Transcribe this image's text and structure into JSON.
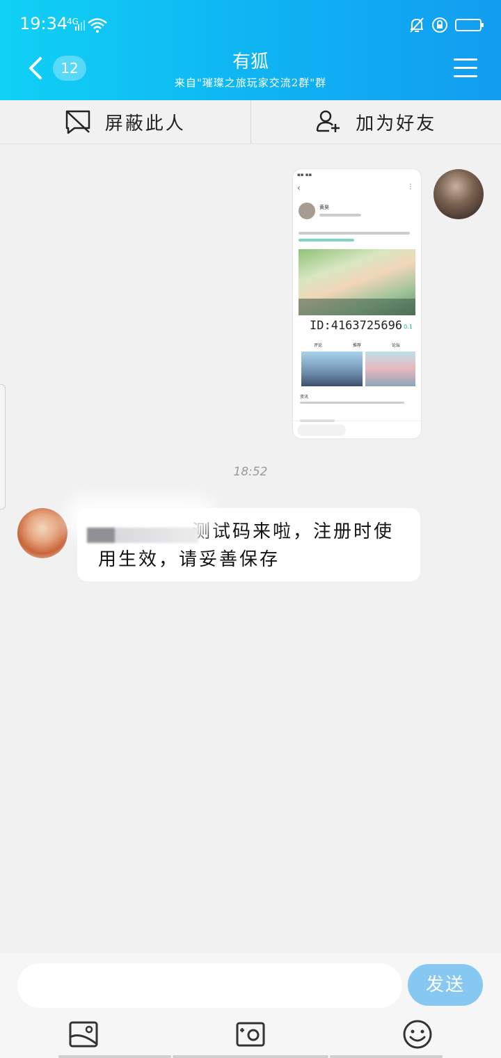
{
  "status_bar": {
    "time": "19:34",
    "network": "4G"
  },
  "header": {
    "unread_count": "12",
    "title": "有狐",
    "subtitle": "来自\"璀璨之旅玩家交流2群\"群"
  },
  "actions": {
    "block_label": "屏蔽此人",
    "add_friend_label": "加为好友"
  },
  "messages": {
    "image_message": {
      "id_text": "ID:4163725696",
      "author": "黄昊",
      "rating": "0.1",
      "tabs": [
        "评论",
        "推荐",
        "论坛"
      ],
      "news": "资讯"
    },
    "timestamp": "18:52",
    "text_message": "测试码来啦，注册时使用生效，请妥善保存"
  },
  "composer": {
    "placeholder": "",
    "send_label": "发送"
  },
  "icons": {
    "back": "chevron-left-icon",
    "menu": "hamburger-menu-icon",
    "block": "block-chat-icon",
    "add_friend": "add-user-icon",
    "image": "image-icon",
    "camera": "camera-icon",
    "emoji": "emoji-icon"
  },
  "colors": {
    "header_start": "#10d1f5",
    "header_end": "#129df0",
    "send_button": "#87c8f2",
    "background": "#f1f1f1"
  }
}
